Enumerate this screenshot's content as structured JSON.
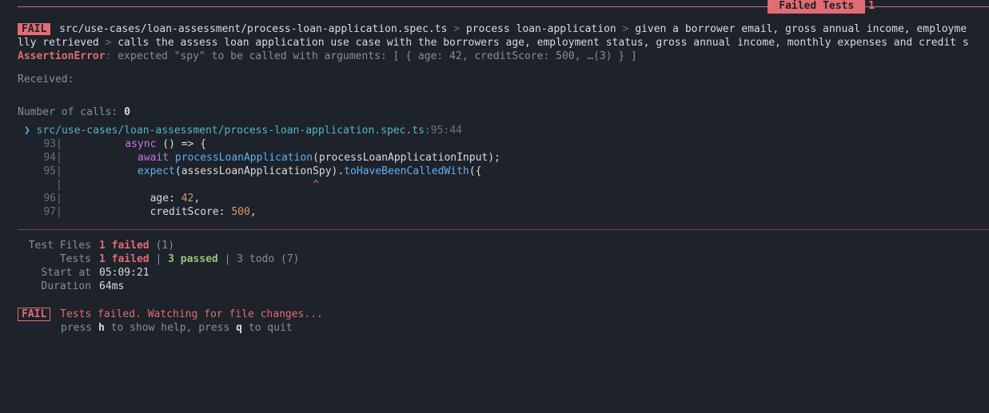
{
  "banner": {
    "label": "Failed Tests",
    "count": "1"
  },
  "fail": {
    "badge": "FAIL",
    "path": "src/use-cases/loan-assessment/process-loan-application.spec.ts",
    "sep1": ">",
    "suite": "process loan-application",
    "sep2": ">",
    "given_trunc": "given a borrower email, gross annual income, employme",
    "line2_prefix": "lly retrieved",
    "sep3": ">",
    "test_name": "calls the assess loan application use case with the borrowers age, employment status, gross annual income, monthly expenses and credit s"
  },
  "err": {
    "type": "AssertionError",
    "colon": ": ",
    "msg_a": "expected \"spy\" to be called with arguments: [ { age: ",
    "msg_42": "42",
    "msg_b": ", creditScore: ",
    "msg_500": "500",
    "msg_c": ", …(3) } ]"
  },
  "received": "Received:",
  "ncalls": {
    "label": "Number of calls: ",
    "value": "0"
  },
  "trace": {
    "marker": "❯",
    "path": "src/use-cases/loan-assessment/process-loan-application.spec.ts",
    "loc": ":95:44"
  },
  "code": {
    "l93": {
      "n": "93",
      "kw": "async",
      "rest": " () => {"
    },
    "l94": {
      "n": "94",
      "kw": "await",
      "fn": "processLoanApplication",
      "rest1": "(processLoanApplicationInput);"
    },
    "l95": {
      "n": "95",
      "fn1": "expect",
      "arg": "(assessLoanApplicationSpy).",
      "fn2": "toHaveBeenCalledWith",
      "rest": "({"
    },
    "caret": "^",
    "l96": {
      "n": "96",
      "key": "age",
      "colon": ": ",
      "val": "42",
      "comma": ","
    },
    "l97": {
      "n": "97",
      "key": "creditScore",
      "colon": ": ",
      "val": "500",
      "comma": ","
    }
  },
  "summary": {
    "files": {
      "label": "Test Files",
      "failed": "1 failed",
      "total": "(1)"
    },
    "tests": {
      "label": "Tests",
      "failed": "1 failed",
      "sep1": "|",
      "passed": "3 passed",
      "sep2": "|",
      "todo": "3 todo (7)"
    },
    "start": {
      "label": "Start at",
      "value": "05:09:21"
    },
    "duration": {
      "label": "Duration",
      "value": "64ms"
    }
  },
  "footer": {
    "badge": "FAIL",
    "msg": "Tests failed. Watching for file changes...",
    "hint_a": "press ",
    "key_h": "h",
    "hint_b": " to show help, press ",
    "key_q": "q",
    "hint_c": " to quit"
  }
}
